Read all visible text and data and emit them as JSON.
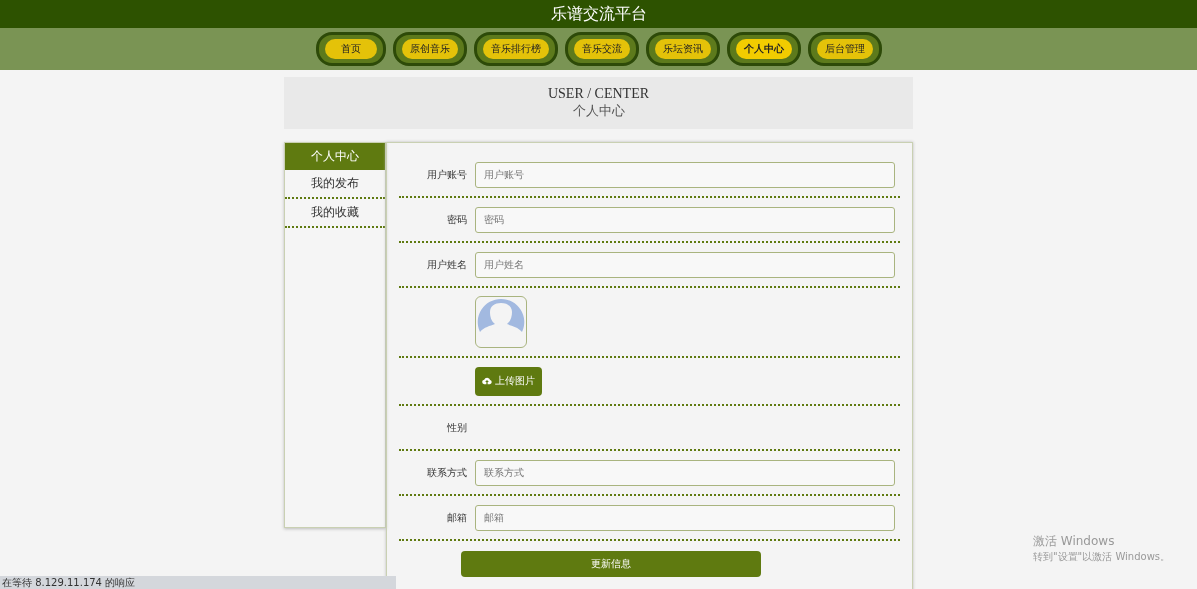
{
  "header": {
    "title": "乐谱交流平台"
  },
  "nav": [
    {
      "label": "首页",
      "selected": false
    },
    {
      "label": "原创音乐",
      "selected": false
    },
    {
      "label": "音乐排行榜",
      "selected": false
    },
    {
      "label": "音乐交流",
      "selected": false
    },
    {
      "label": "乐坛资讯",
      "selected": false
    },
    {
      "label": "个人中心",
      "selected": true
    },
    {
      "label": "后台管理",
      "selected": false
    }
  ],
  "banner": {
    "title": "USER / CENTER",
    "subtitle": "个人中心"
  },
  "sidebar": {
    "items": [
      {
        "label": "个人中心",
        "selected": true
      },
      {
        "label": "我的发布",
        "selected": false
      },
      {
        "label": "我的收藏",
        "selected": false
      }
    ]
  },
  "form": {
    "rows": [
      {
        "kind": "input",
        "label": "用户账号",
        "placeholder": "用户账号"
      },
      {
        "kind": "input",
        "label": "密码",
        "placeholder": "密码"
      },
      {
        "kind": "input",
        "label": "用户姓名",
        "placeholder": "用户姓名"
      },
      {
        "kind": "avatar"
      },
      {
        "kind": "upload",
        "button": "上传图片"
      },
      {
        "kind": "label",
        "label": "性别"
      },
      {
        "kind": "input",
        "label": "联系方式",
        "placeholder": "联系方式"
      },
      {
        "kind": "input",
        "label": "邮箱",
        "placeholder": "邮箱"
      }
    ],
    "submit": "更新信息"
  },
  "status_bar": {
    "text": "在等待 8.129.11.174 的响应"
  },
  "os_notice": {
    "title": "激活 Windows",
    "text": "转到\"设置\"以激活 Windows。"
  }
}
